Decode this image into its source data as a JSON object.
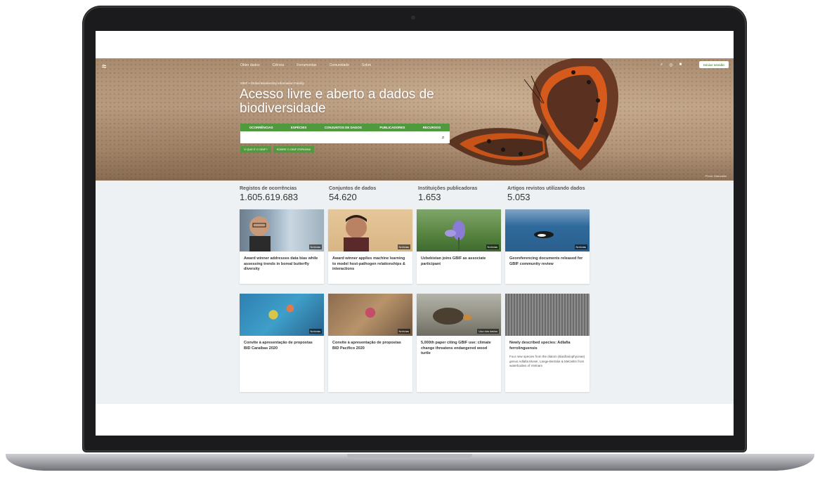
{
  "nav": {
    "logo": "≈",
    "links": [
      "Obter dados",
      "Ciência",
      "Ferramentas",
      "Comunidade",
      "Sobre"
    ],
    "login": "Iniciar sessão"
  },
  "hero": {
    "breadcrumb": "GBIF • Global Biodiversity Information Facility",
    "title": "Acesso livre e aberto a dados de biodiversidade",
    "tabs": [
      "OCORRÊNCIAS",
      "ESPÉCIES",
      "CONJUNTOS DE DADOS",
      "PUBLICADORES",
      "RECURSOS"
    ],
    "search_placeholder": "",
    "buttons": [
      "O QUE É O GBIF?",
      "SOBRE O GBIF ESPANHA"
    ],
    "photo_credit": "Photo: iNaturalist"
  },
  "stats": [
    {
      "label": "Registos de ocorrências",
      "value": "1.605.619.683"
    },
    {
      "label": "Conjuntos de dados",
      "value": "54.620"
    },
    {
      "label": "Instituições publicadoras",
      "value": "1.653"
    },
    {
      "label": "Artigos revistos utilizando dados",
      "value": "5.053"
    }
  ],
  "cards": [
    {
      "tag": "Notícias",
      "title": "Award winner addresses data bias while assessing trends in boreal butterfly diversity",
      "desc": ""
    },
    {
      "tag": "Notícias",
      "title": "Award winner applies machine learning to model host-pathogen relationships & interactions",
      "desc": ""
    },
    {
      "tag": "Notícias",
      "title": "Uzbekistan joins GBIF as associate participant",
      "desc": ""
    },
    {
      "tag": "Notícias",
      "title": "Georeferencing documents released for GBIF community review",
      "desc": ""
    },
    {
      "tag": "Notícias",
      "title": "Convite à apresentação de propostas BID Caraíbas 2020",
      "desc": ""
    },
    {
      "tag": "Notícias",
      "title": "Convite à apresentação de propostas BID Pacífico 2020",
      "desc": ""
    },
    {
      "tag": "Uso dos dados",
      "title": "5,000th paper citing GBIF use: climate change threatens endangered wood turtle",
      "desc": ""
    },
    {
      "tag": "",
      "title": "Newly described species: Adlafia ferrolinguensis",
      "desc": "Four new species from the diatom (Bacillariophyceae) genus Adlafia Moser, Lange-Bertalot & Metzeltin from waterbodies of Vietnam"
    }
  ]
}
